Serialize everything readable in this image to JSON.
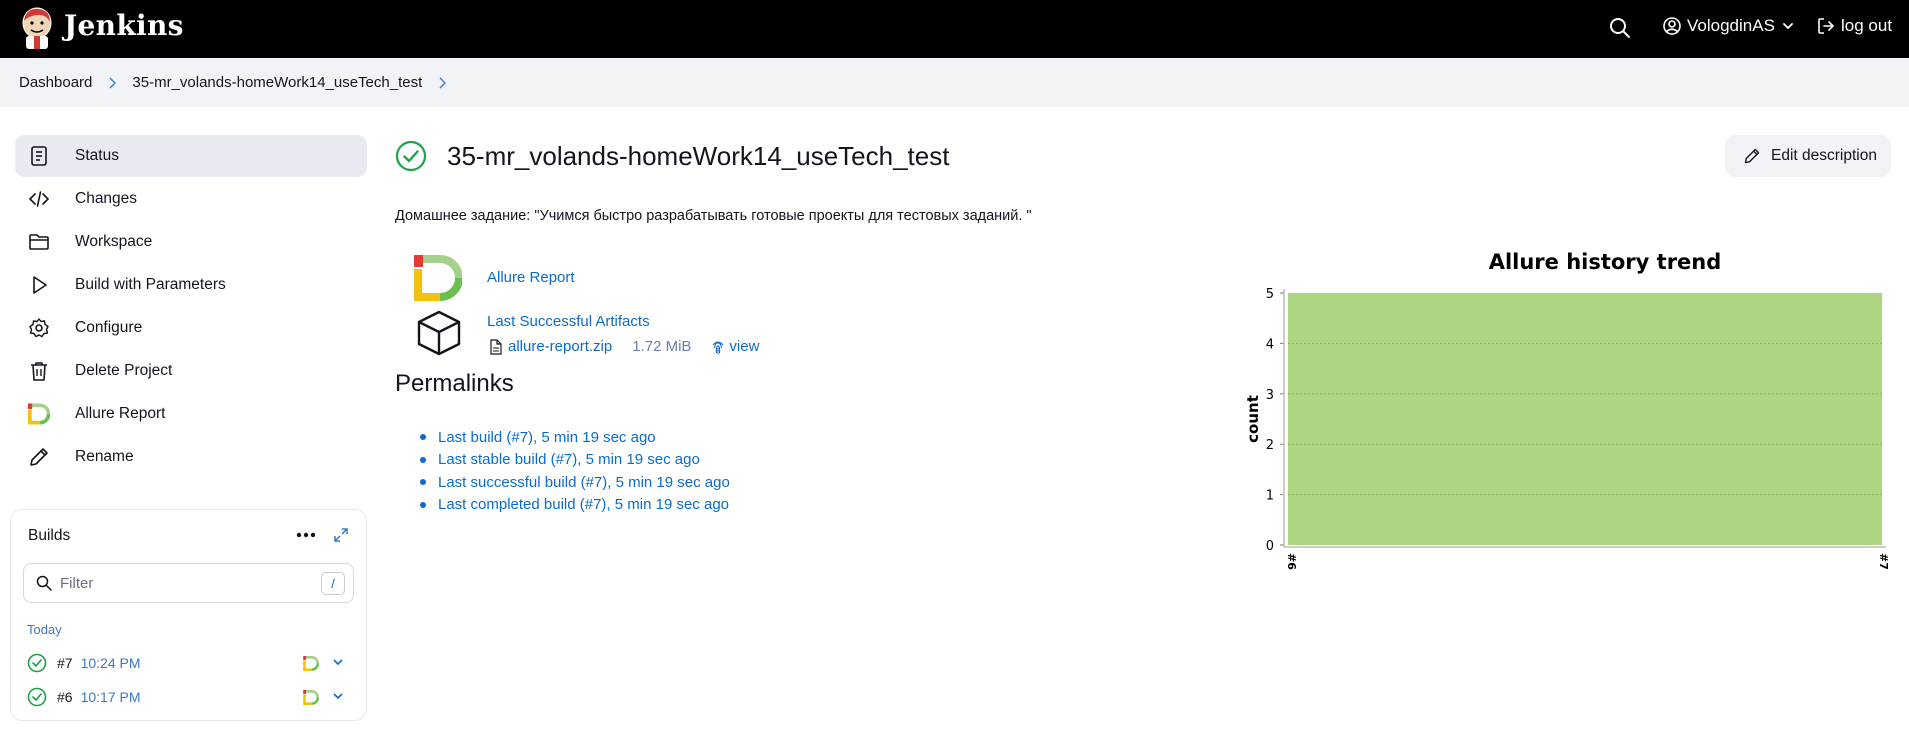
{
  "header": {
    "brand": "Jenkins",
    "user_name": "VologdinAS",
    "logout_label": "log out"
  },
  "breadcrumbs": [
    "Dashboard",
    "35-mr_volands-homeWork14_useTech_test"
  ],
  "sidebar": {
    "items": [
      {
        "label": "Status",
        "icon": "status-icon",
        "active": true
      },
      {
        "label": "Changes",
        "icon": "code-icon"
      },
      {
        "label": "Workspace",
        "icon": "folder-icon"
      },
      {
        "label": "Build with Parameters",
        "icon": "play-icon"
      },
      {
        "label": "Configure",
        "icon": "gear-icon"
      },
      {
        "label": "Delete Project",
        "icon": "trash-icon"
      },
      {
        "label": "Allure Report",
        "icon": "allure-icon"
      },
      {
        "label": "Rename",
        "icon": "pencil-icon"
      }
    ]
  },
  "builds": {
    "title": "Builds",
    "filter_placeholder": "Filter",
    "filter_shortcut": "/",
    "group_label": "Today",
    "rows": [
      {
        "number": "#7",
        "time": "10:24 PM",
        "status": "success"
      },
      {
        "number": "#6",
        "time": "10:17 PM",
        "status": "success"
      }
    ]
  },
  "main": {
    "title": "35-mr_volands-homeWork14_useTech_test",
    "edit_description_label": "Edit description",
    "description": "Домашнее задание: \"Учимся быстро разрабатывать готовые проекты для тестовых заданий. \"",
    "allure_link": "Allure Report",
    "artifacts_link": "Last Successful Artifacts",
    "artifact": {
      "name": "allure-report.zip",
      "size": "1.72 MiB",
      "view_label": "view"
    },
    "permalinks_heading": "Permalinks",
    "permalinks": [
      "Last build (#7), 5 min 19 sec ago",
      "Last stable build (#7), 5 min 19 sec ago",
      "Last successful build (#7), 5 min 19 sec ago",
      "Last completed build (#7), 5 min 19 sec ago"
    ]
  },
  "colors": {
    "header_bg": "#000000",
    "link": "#0b6bcb",
    "success": "#1ea446",
    "chart_fill": "#aed581"
  },
  "chart_data": {
    "type": "area",
    "title": "Allure history trend",
    "ylabel": "count",
    "xlabel": "",
    "categories": [
      "#6",
      "#7"
    ],
    "series": [
      {
        "values": [
          5,
          5
        ]
      }
    ],
    "ylim": [
      0,
      5
    ],
    "yticks": [
      0,
      1,
      2,
      3,
      4,
      5
    ],
    "grid": true
  }
}
